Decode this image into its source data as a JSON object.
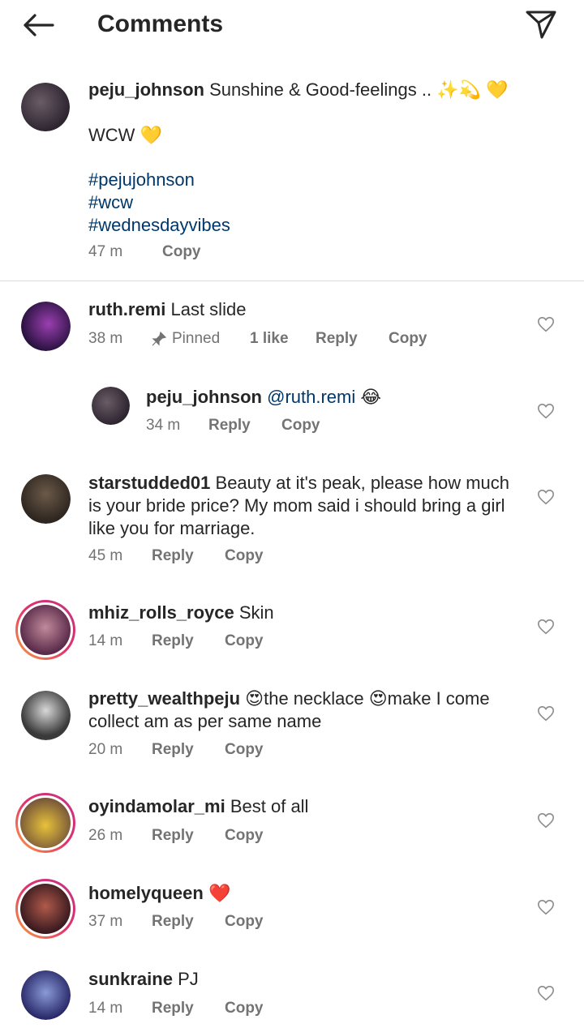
{
  "header": {
    "title": "Comments",
    "back_icon": "arrow-left-icon",
    "send_icon": "paper-plane-icon"
  },
  "caption": {
    "username": "peju_johnson",
    "text": "Sunshine & Good-feelings .. ✨💫 💛",
    "line2": "WCW 💛",
    "hashtags": [
      "#pejujohnson",
      "#wcw",
      "#wednesdayvibes"
    ],
    "time": "47 m",
    "copy": "Copy"
  },
  "comments": [
    {
      "username": "ruth.remi",
      "text": "Last slide",
      "time": "38 m",
      "pinned": "Pinned",
      "likes": "1 like",
      "reply": "Reply",
      "copy": "Copy"
    },
    {
      "username": "peju_johnson",
      "mention": "@ruth.remi",
      "emoji": "😂",
      "time": "34 m",
      "reply": "Reply",
      "copy": "Copy"
    },
    {
      "username": "starstudded01",
      "text": "Beauty at it's peak, please how much is your bride price? My mom said i should bring a girl like you for marriage.",
      "time": "45 m",
      "reply": "Reply",
      "copy": "Copy"
    },
    {
      "username": "mhiz_rolls_royce",
      "text": "Skin",
      "time": "14 m",
      "reply": "Reply",
      "copy": "Copy"
    },
    {
      "username": "pretty_wealthpeju",
      "text": "😍the necklace 😍make I come collect am as per same name",
      "time": "20 m",
      "reply": "Reply",
      "copy": "Copy"
    },
    {
      "username": "oyindamolar_mi",
      "text": "Best of all",
      "time": "26 m",
      "reply": "Reply",
      "copy": "Copy"
    },
    {
      "username": "homelyqueen",
      "text": "❤️",
      "time": "37 m",
      "reply": "Reply",
      "copy": "Copy"
    },
    {
      "username": "sunkraine",
      "text": "PJ",
      "time": "14 m",
      "reply": "Reply",
      "copy": "Copy"
    }
  ],
  "colors": {
    "link": "#00376b",
    "secondary": "#737373",
    "heart_outline": "#8e8e8e",
    "story_ring_start": "#f9a23b",
    "story_ring_end": "#c13584"
  }
}
